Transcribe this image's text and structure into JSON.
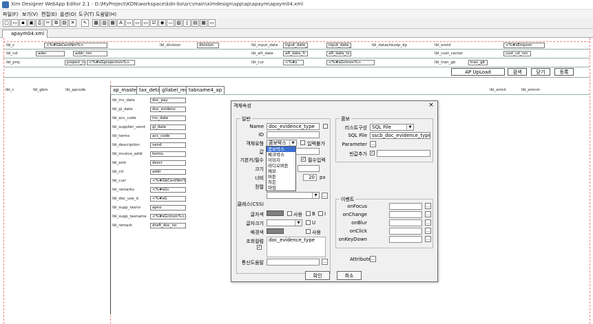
{
  "window": {
    "title": "Xim Designer WebApp Editor 2.1 - D:\\MyProject\\KDN\\workspace\\kdn-bo\\src\\main\\ximdesign\\app\\ap\\apaym\\apaym04.xml"
  },
  "menu": [
    "파일(F)",
    "보기(V)",
    "편집(E)",
    "옵션(O)",
    "도구(T)",
    "도움말(H)"
  ],
  "toolbar_icons": [
    "new-icon",
    "open-icon",
    "save-icon",
    "save-all-icon",
    "print-icon",
    "cut-icon",
    "copy-icon",
    "paste-icon",
    "delete-icon",
    "pointer-icon",
    "form-icon",
    "grid-icon",
    "table-icon",
    "label-icon",
    "textbox-icon",
    "button-icon",
    "combobox-icon",
    "checkbox-icon",
    "radio-icon",
    "line-icon",
    "image-icon",
    "tab-icon",
    "multitab-icon",
    "calendar-icon",
    "other-icon"
  ],
  "doc_tab": "apaym04.xml",
  "canvas": {
    "row1": {
      "l1": "lbl_c",
      "f1": "<%#GbCentNm%>",
      "l2": "lbl_division",
      "f2": "division",
      "l3": "lbl_input_date",
      "f3": "input_date_fr",
      "f4": "input_date_to",
      "l4": "lbl_datachksdp_dp",
      "f5": "lbl_emid",
      "f6": "<%#sEmpnm",
      "l5": "lbl_nd",
      "f7": "ader",
      "f8": "addr_nm",
      "l6": "lbl_aft_date",
      "f9": "aft_date_fr",
      "f10": "aft_date_to",
      "l7": "lbl_cost_center",
      "f11": "cost_cd_nm",
      "l8": "lbl_proj",
      "f12": "project_nm",
      "f13": "<%#sGprojectnm%>",
      "l9": "lbl_cur",
      "f14": "<%#s",
      "f15": "<%#sGctmm%>",
      "l10": "lbl_tran_gb",
      "f16": "tran_gb"
    },
    "buttons": [
      "AP UpLoad",
      "검색",
      "닫기",
      "등록"
    ],
    "header_row": [
      "lbl_c",
      "lbl_gbm",
      "lbl_lr",
      "lbl_apcode",
      "lbl_emid",
      "lbl_emnm"
    ],
    "tabs": [
      "ap_master",
      "tax_detail",
      "gllabel_rec",
      "tabname4_ap"
    ],
    "form_labels": [
      "lbl_inv_date",
      "lbl_gl_date",
      "lbl_acc_code",
      "lbl_supplier_vend",
      "lbl_terms",
      "lbl_description",
      "lbl_invoice_addr",
      "lbl_amt",
      "lbl_ctr",
      "lbl_curr",
      "lbl_remarks",
      "lbl_doc_use_d",
      "lbl_supp_taxno",
      "lbl_supp_taxname",
      "lbl_remark"
    ],
    "form_values": [
      "doc_pay",
      "doc_evidenc",
      "inv_date",
      "gl_date",
      "acc_code",
      "vend",
      "terms",
      "descr",
      "addr",
      "<%#GbCentNm%>",
      "<%#sGc",
      "<%#sG",
      "apno",
      "<%#sGctmm%>",
      "draft_doc_no",
      "supp_taxno",
      "supp_taxnm",
      "note"
    ]
  },
  "dialog": {
    "title": "객체속성",
    "close": "×",
    "group_general": "일반",
    "labels": {
      "name": "Name",
      "id": "ID",
      "type": "객체유형",
      "value": "값",
      "default_must": "기본키/필수",
      "size": "크기",
      "width": "너비",
      "align": "정렬",
      "css": "클래스(CSS)",
      "forecolor": "글자색",
      "fontsize": "글자크기",
      "backcolor": "배경색",
      "query": "조회컬럼",
      "pagefn": "통신도움말"
    },
    "name_value": "doc_evidence_type",
    "type_value": "콤보박스",
    "readonly_label": "입력불가",
    "required_label": "필수입력",
    "width_value": "20",
    "width_unit": "px",
    "use_label": "사용",
    "b_label": "B",
    "i_label": "I",
    "u_label": "U",
    "query_value": "doc_evidence_type",
    "dropdown_options": [
      "콤보박스",
      "체크박스",
      "이미지",
      "라디오버튼",
      "메모",
      "버튼",
      "히든",
      "마임"
    ],
    "group_combo": "콤보",
    "list_type_label": "리스트구성",
    "list_type_value": "SQL File",
    "sqlfile_label": "SQL File",
    "sqlfile_value": "sscb_doc_evidence_type.sql",
    "param_label": "Parameter",
    "blank_label": "빈값추가",
    "group_event": "이벤트",
    "events": [
      "onFocus",
      "onChange",
      "onBlur",
      "onClick",
      "onKeyDown"
    ],
    "attribute_label": "Attribute",
    "ok": "확인",
    "cancel": "취소"
  }
}
